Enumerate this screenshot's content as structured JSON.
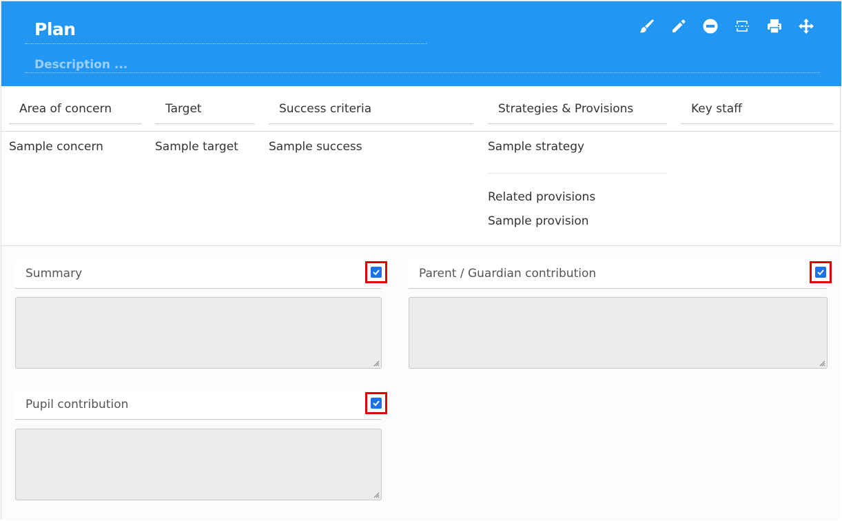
{
  "header": {
    "title": "Plan",
    "description_placeholder": "Description ...",
    "background_color": "#2196f3",
    "toolbar": [
      {
        "name": "paint-brush-icon"
      },
      {
        "name": "pencil-icon"
      },
      {
        "name": "minus-circle-icon"
      },
      {
        "name": "unlink-icon"
      },
      {
        "name": "print-icon"
      },
      {
        "name": "move-icon"
      }
    ]
  },
  "columns": [
    "Area of concern",
    "Target",
    "Success criteria",
    "Strategies & Provisions",
    "Key staff"
  ],
  "row": {
    "concern": "Sample concern",
    "target": "Sample target",
    "success": "Sample success",
    "strategy": "Sample strategy",
    "related_label": "Related provisions",
    "provision": "Sample provision",
    "key_staff": ""
  },
  "fields": {
    "summary": {
      "label": "Summary",
      "checked": true
    },
    "parent": {
      "label": "Parent / Guardian contribution",
      "checked": true
    },
    "pupil": {
      "label": "Pupil contribution",
      "checked": true
    }
  },
  "colors": {
    "checkbox": "#1a73e8",
    "highlight": "#e00000"
  }
}
